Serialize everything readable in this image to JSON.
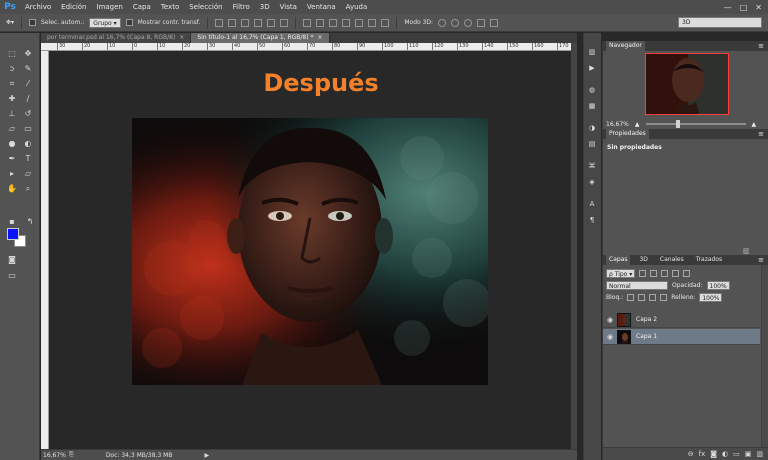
{
  "app": {
    "logo": "Ps",
    "menu": [
      "Archivo",
      "Edición",
      "Imagen",
      "Capa",
      "Texto",
      "Selección",
      "Filtro",
      "3D",
      "Vista",
      "Ventana",
      "Ayuda"
    ],
    "window_controls": [
      "—",
      "□",
      "✕"
    ]
  },
  "options_bar": {
    "auto_select_label": "Selec. autom.:",
    "auto_select_mode": "Grupo",
    "show_transform_label": "Mostrar contr. transf.",
    "mode_3d_label": "Modo 3D:",
    "workspace": "3D"
  },
  "tabs": [
    {
      "label": "por terminar.psd al 16,7% (Capa 8, RGB/8)",
      "close": "×",
      "active": false
    },
    {
      "label": "Sin título-1 al 16,7% (Capa 1, RGB/8) *",
      "close": "×",
      "active": true
    }
  ],
  "ruler": {
    "top_ticks": [
      "30",
      "20",
      "10",
      "0",
      "10",
      "20",
      "30",
      "40",
      "50",
      "60",
      "70",
      "80",
      "90",
      "100",
      "110",
      "120",
      "130",
      "140",
      "150",
      "160",
      "170"
    ]
  },
  "canvas": {
    "title": "Después",
    "title_color": "#f3812b"
  },
  "status": {
    "zoom": "16,67%",
    "doc": "Doc: 34,3 MB/38,3 MB",
    "arrow": "▶"
  },
  "navigator": {
    "title": "Navegador",
    "zoom": "16,67%",
    "frame_color": "#ff3b3b"
  },
  "properties": {
    "title": "Propiedades",
    "empty_text": "Sin propiedades"
  },
  "layers_panel": {
    "tabs": [
      "Capas",
      "3D",
      "Canales",
      "Trazados"
    ],
    "filter_label": "ρ Tipo",
    "blend_mode": "Normal",
    "opacity_label": "Opacidad:",
    "opacity_value": "100%",
    "lock_label": "Bloq.:",
    "fill_label": "Relleno:",
    "fill_value": "100%",
    "layers": [
      {
        "name": "Capa 2",
        "selected": false
      },
      {
        "name": "Capa 1",
        "selected": true
      }
    ]
  },
  "colors": {
    "foreground": "#0a12ff",
    "background": "#ffffff"
  }
}
